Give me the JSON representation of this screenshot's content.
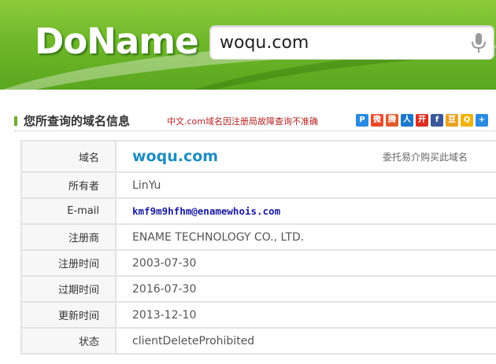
{
  "header": {
    "logo": "DoName",
    "search_value": "woqu.com"
  },
  "section": {
    "title": "您所查询的域名信息",
    "notice": "中文.com域名因注册局故障查询不准确",
    "share_icons": [
      {
        "name": "pengyou-icon",
        "glyph": "P",
        "color": "#2a8be0"
      },
      {
        "name": "weibo-icon",
        "glyph": "微",
        "color": "#e84a2c"
      },
      {
        "name": "tencent-weibo-icon",
        "glyph": "腾",
        "color": "#e25b2d"
      },
      {
        "name": "renren-icon",
        "glyph": "人",
        "color": "#1a77c9"
      },
      {
        "name": "kaixin-icon",
        "glyph": "开",
        "color": "#d82f21"
      },
      {
        "name": "facebook-icon",
        "glyph": "f",
        "color": "#3b5998"
      },
      {
        "name": "douban-icon",
        "glyph": "豆",
        "color": "#e8a21e"
      },
      {
        "name": "qzone-icon",
        "glyph": "Q",
        "color": "#f0b400"
      },
      {
        "name": "more-share-icon",
        "glyph": "+",
        "color": "#2a8be0"
      }
    ]
  },
  "buy_link": "委托易介购买此域名",
  "rows": [
    {
      "key": "域名",
      "value": "woqu.com"
    },
    {
      "key": "所有者",
      "value": "LinYu"
    },
    {
      "key": "E-mail",
      "value": "kmf9m9hfhm@enamewhois.com"
    },
    {
      "key": "注册商",
      "value": "ENAME TECHNOLOGY CO., LTD."
    },
    {
      "key": "注册时间",
      "value": "2003-07-30"
    },
    {
      "key": "过期时间",
      "value": "2016-07-30"
    },
    {
      "key": "更新时间",
      "value": "2013-12-10"
    },
    {
      "key": "状态",
      "value": "clientDeleteProhibited"
    }
  ]
}
